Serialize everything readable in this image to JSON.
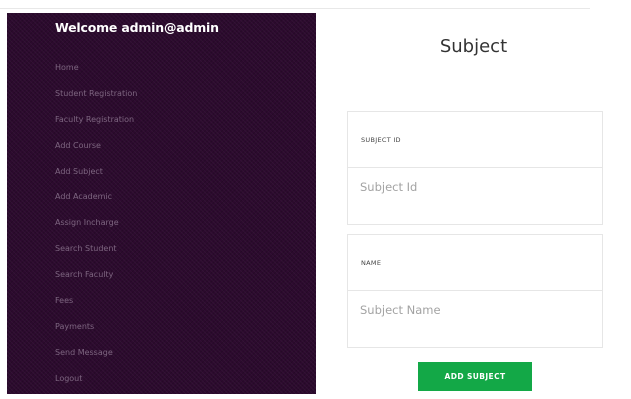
{
  "sidebar": {
    "welcome": "Welcome admin@admin",
    "items": [
      {
        "label": "Home"
      },
      {
        "label": "Student Registration"
      },
      {
        "label": "Faculty Registration"
      },
      {
        "label": "Add Course"
      },
      {
        "label": "Add Subject"
      },
      {
        "label": "Add Academic"
      },
      {
        "label": "Assign Incharge"
      },
      {
        "label": "Search Student"
      },
      {
        "label": "Search Faculty"
      },
      {
        "label": "Fees"
      },
      {
        "label": "Payments"
      },
      {
        "label": "Send Message"
      },
      {
        "label": "Logout"
      }
    ]
  },
  "form": {
    "title": "Subject",
    "subject_id": {
      "label": "SUBJECT ID",
      "value": "",
      "placeholder": "Subject Id"
    },
    "name": {
      "label": "NAME",
      "value": "",
      "placeholder": "Subject Name"
    },
    "submit_label": "ADD SUBJECT"
  },
  "colors": {
    "sidebar_bg": "#2c0a2e",
    "sidebar_text": "#7e6681",
    "button_bg": "#13a847"
  }
}
